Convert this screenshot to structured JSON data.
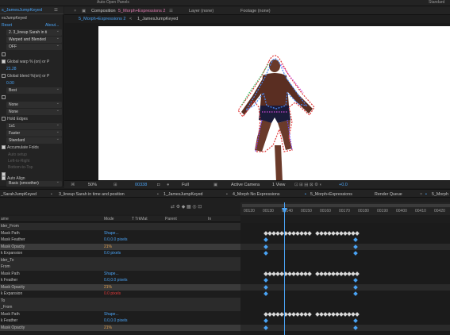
{
  "top": {
    "left_text": "Auto-Open Panels",
    "right_text": "Standard"
  },
  "effect_controls": {
    "tab": "s_JamesJumpKeyed",
    "layer_name": "esJumpKeyed",
    "reset": "Reset",
    "about": "About...",
    "dropdown1": "2. 3_lineup Sarah in ti",
    "dropdown2": "Warped and Blended",
    "dropdown3": "OFF",
    "global_warp_label": "Global warp % (on) or P",
    "global_warp_value": "21.28",
    "global_blend_label": "Global blend %(on) or P",
    "global_blend_value": "0.00",
    "quality": "Best",
    "none1": "None",
    "none2": "None",
    "hold_edges": "Hold Edges",
    "res": "1x1",
    "speed": "Faster",
    "standard": "Standard",
    "accumulate": "Accumulate Folds",
    "dim1": "Auto setup",
    "dim2": "Left-to-Right",
    "dim3": "Bottom-to-Top",
    "auto_align": "Auto Align",
    "basic": "Basic (smoother)"
  },
  "composition": {
    "tab_title": "Composition",
    "comp_name": "5_Morph+Expressions 2",
    "layer_panel": "Layer (none)",
    "footage_panel": "Footage (none)",
    "sub_tab1": "5_Morph+Expressions 2",
    "sub_tab2": "1_JamesJumpKeyed",
    "zoom": "50%",
    "timecode": "00338",
    "res": "Full",
    "camera": "Active Camera",
    "view": "1 View",
    "exposure": "+0.0"
  },
  "timeline_tabs": [
    "_SarahJumpKeyed",
    "3_lineup Sarah in time and position",
    "1_JamesJumpKeyed",
    "4_Morph No Expressions",
    "5_Morph+Expressions",
    "Render Queue",
    "5_Morph"
  ],
  "ruler": [
    "00120",
    "00130",
    "00140",
    "00150",
    "00160",
    "00170",
    "00180",
    "00190",
    "00400",
    "00410",
    "00420"
  ],
  "columns": {
    "name": "ame",
    "mode": "Mode",
    "trkmat": "T TrkMat",
    "parent": "Parent",
    "in": "In"
  },
  "layers": [
    {
      "name": "lder_From",
      "value": "",
      "style": "sec"
    },
    {
      "name": "Mask Path",
      "value": "Shape...",
      "style": ""
    },
    {
      "name": "Mask Feather",
      "value": "0.0,0.0 pixels",
      "style": ""
    },
    {
      "name": "Mask Opacity",
      "value": "21%",
      "style": "hl"
    },
    {
      "name": "k Expansion",
      "value": "0.0 pixels",
      "style": ""
    },
    {
      "name": "lder_To",
      "value": "",
      "style": "sec"
    },
    {
      "name": "From",
      "value": "",
      "style": "sec"
    },
    {
      "name": "Mask Path",
      "value": "Shape...",
      "style": ""
    },
    {
      "name": "k Feather",
      "value": "0.0,0.0 pixels",
      "style": ""
    },
    {
      "name": "Mask Opacity",
      "value": "21%",
      "style": "hl"
    },
    {
      "name": "k Expansion",
      "value": "0.0 pixels",
      "style": ""
    },
    {
      "name": "To",
      "value": "",
      "style": "sec"
    },
    {
      "name": "_From",
      "value": "",
      "style": "sec"
    },
    {
      "name": "Mask Path",
      "value": "Shape...",
      "style": ""
    },
    {
      "name": "k Feather",
      "value": "0.0,0.0 pixels",
      "style": ""
    },
    {
      "name": "Mask Opacity",
      "value": "21%",
      "style": "hl"
    }
  ],
  "colors": {
    "accent": "#4aa3f5",
    "panel": "#232323",
    "red": "#e03a3a"
  }
}
